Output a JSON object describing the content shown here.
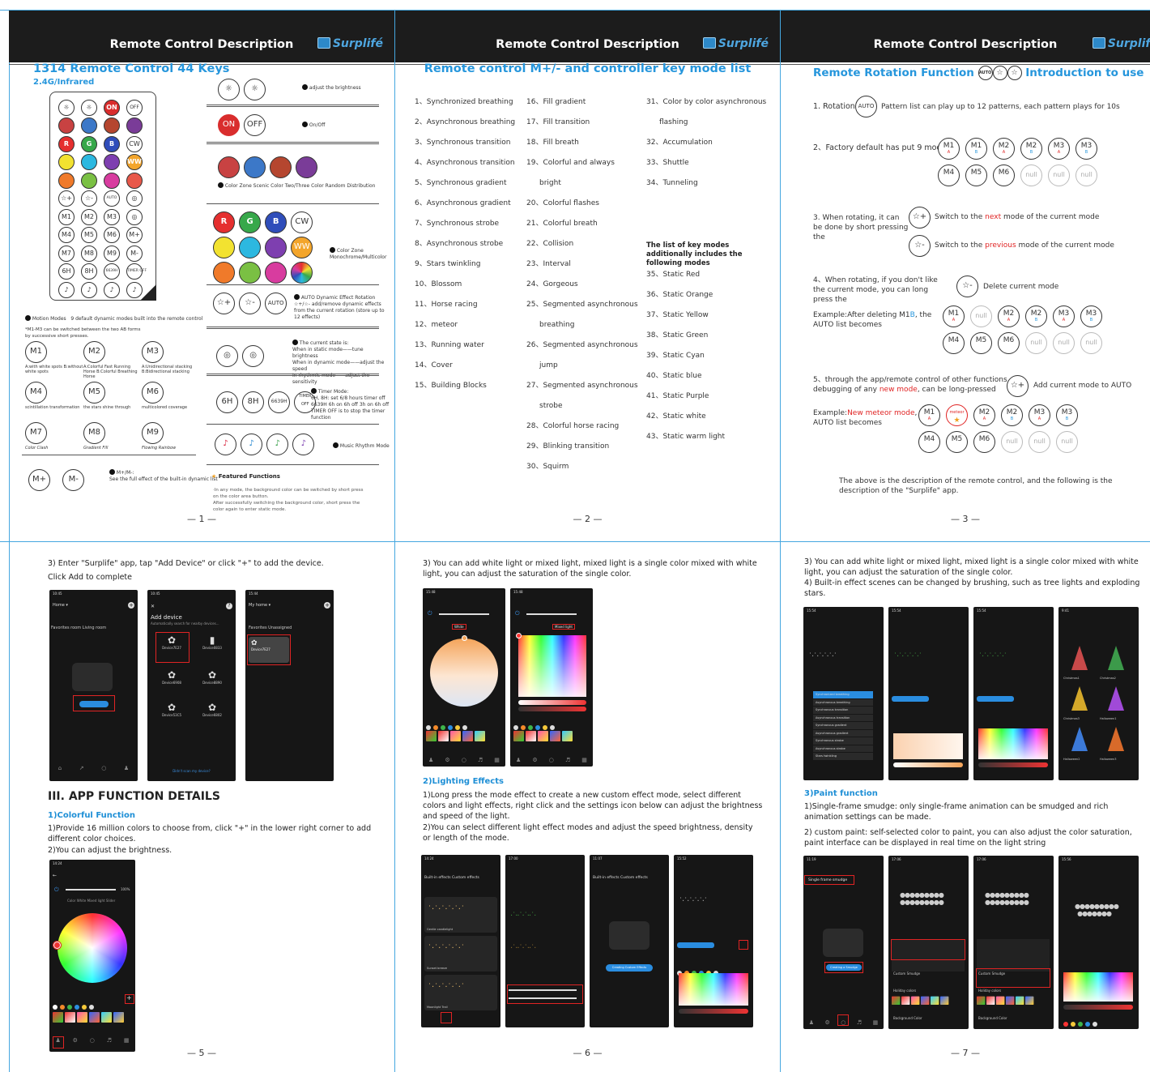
{
  "header": {
    "title": "Remote Control Description",
    "logo": "Surplifé"
  },
  "page1": {
    "title": "1314 Remote Control 44 Keys",
    "subtitle": "2.4G/Infrared",
    "remote_rows": [
      [
        {
          "t": "☼",
          "c": ""
        },
        {
          "t": "☼",
          "c": ""
        },
        {
          "t": "ON",
          "c": "#d92d2d"
        },
        {
          "t": "OFF",
          "c": ""
        }
      ],
      [
        {
          "t": "",
          "c": "#c84242"
        },
        {
          "t": "",
          "c": "#3c78c8"
        },
        {
          "t": "",
          "c": "#b5462f"
        },
        {
          "t": "",
          "c": "#7a3c98"
        }
      ],
      [
        {
          "t": "R",
          "c": "#e52f2f"
        },
        {
          "t": "G",
          "c": "#37a84a"
        },
        {
          "t": "B",
          "c": "#2f4dba"
        },
        {
          "t": "CW",
          "c": ""
        }
      ],
      [
        {
          "t": "",
          "c": "#f2e230"
        },
        {
          "t": "",
          "c": "#2cb8e0"
        },
        {
          "t": "",
          "c": "#7e3fb0"
        },
        {
          "t": "WW",
          "c": "#f3a52b"
        }
      ],
      [
        {
          "t": "",
          "c": "#f07a2a"
        },
        {
          "t": "",
          "c": "#7ac043"
        },
        {
          "t": "",
          "c": "#d83c9f"
        },
        {
          "t": "",
          "c": "#e8584a"
        }
      ],
      [
        {
          "t": "☆+",
          "c": ""
        },
        {
          "t": "☆-",
          "c": ""
        },
        {
          "t": "AUTO",
          "c": ""
        },
        {
          "t": "◎",
          "c": ""
        }
      ],
      [
        {
          "t": "M1",
          "c": ""
        },
        {
          "t": "M2",
          "c": ""
        },
        {
          "t": "M3",
          "c": ""
        },
        {
          "t": "◎",
          "c": ""
        }
      ],
      [
        {
          "t": "M4",
          "c": ""
        },
        {
          "t": "M5",
          "c": ""
        },
        {
          "t": "M6",
          "c": ""
        },
        {
          "t": "M+",
          "c": ""
        }
      ],
      [
        {
          "t": "M7",
          "c": ""
        },
        {
          "t": "M8",
          "c": ""
        },
        {
          "t": "M9",
          "c": ""
        },
        {
          "t": "M-",
          "c": ""
        }
      ],
      [
        {
          "t": "6H",
          "c": ""
        },
        {
          "t": "8H",
          "c": ""
        },
        {
          "t": "6639H",
          "c": ""
        },
        {
          "t": "TIMER OFF",
          "c": ""
        }
      ],
      [
        {
          "t": "♪",
          "c": ""
        },
        {
          "t": "♪",
          "c": ""
        },
        {
          "t": "♪",
          "c": ""
        },
        {
          "t": "♪",
          "c": ""
        }
      ]
    ],
    "brightness": "adjust the brightness",
    "onoff": "On/Off",
    "colorzone_scenic": "Color Zone Scenic Color   Two/Three Color Random Distribution",
    "colorzone": "Color Zone",
    "mono": "Monochrome/Multicolor",
    "auto_title": "AUTO Dynamic Effect Rotation",
    "auto_desc": "☆+/☆- add/remove dynamic effects from the current rotation (store up to 12 effects)",
    "state_title": "The current state is:",
    "state_1": "When in static mode——tune brightness",
    "state_2": "When in dynamic mode——adjust the speed",
    "state_3": "In rhythmic mode——adjust the sensitivity",
    "timer_title": "Timer Mode:",
    "timer_1": "6H, 8H: set 6/8 hours timer off",
    "timer_2": "6639H 6h on 6h off 3h on 6h off",
    "timer_3": "TIMER OFF is to stop the timer function",
    "music": "Music Rhythm Mode",
    "motion_title": "Motion Modes",
    "motion_desc": "9 default dynamic modes built into the remote control",
    "motion_note": "*M1-M3 can be switched between the two AB forms by successive short presses.",
    "modes": [
      {
        "k": "M1",
        "d": "A:with white spots B:without white spots"
      },
      {
        "k": "M2",
        "d": "A:Colorful Fast Running Horse B:Colorful Breathing Horse"
      },
      {
        "k": "M3",
        "d": "A:Unidirectional stacking B:Bidirectional stacking"
      },
      {
        "k": "M4",
        "d": "scintillation transformation"
      },
      {
        "k": "M5",
        "d": "the stars shine through"
      },
      {
        "k": "M6",
        "d": "multicolored coverage"
      },
      {
        "k": "M7",
        "d": "Color Clash"
      },
      {
        "k": "M8",
        "d": "Gradient Fill"
      },
      {
        "k": "M9",
        "d": "Flowing Rainbow"
      }
    ],
    "mplus_title": "M+/M-:",
    "mplus_desc": "See the full effect of the built-in dynamic list",
    "featured": "Featured Functions",
    "feat_1": "·In any mode, the background color can be switched by short press",
    "feat_2": "on the color area button.",
    "feat_3": "After successfully switching the background color, short press the",
    "feat_4": "color again to enter static mode.",
    "page_no": "— 1 —"
  },
  "page2": {
    "title": "Remote control M+/- and controller key mode list",
    "col1": [
      "1、Synchronized breathing",
      "2、Asynchronous breathing",
      "3、Synchronous transition",
      "4、Asynchronous transition",
      "5、Synchronous gradient",
      "6、Asynchronous gradient",
      "7、Synchronous strobe",
      "8、Asynchronous strobe",
      "9、Stars twinkling",
      "10、Blossom",
      "11、Horse racing",
      "12、meteor",
      "13、Running water",
      "14、Cover",
      "15、Building Blocks"
    ],
    "col2": [
      "16、Fill gradient",
      "17、Fill transition",
      "18、Fill breath",
      "19、Colorful and always",
      "bright",
      "20、Colorful flashes",
      "21、Colorful breath",
      "22、Collision",
      "23、Interval",
      "24、Gorgeous",
      "25、Segmented asynchronous",
      "breathing",
      "26、Segmented asynchronous",
      "jump",
      "27、Segmented asynchronous",
      "strobe",
      "28、Colorful horse racing",
      "29、Blinking transition",
      "30、Squirm"
    ],
    "col3a": [
      "31、Color by color asynchronous",
      "flashing",
      "32、Accumulation",
      "33、Shuttle",
      "34、Tunneling"
    ],
    "col3_head": "The list of key modes additionally includes the following modes",
    "col3b": [
      "35、Static Red",
      "36、Static Orange",
      "37、Static Yellow",
      "38、Static Green",
      "39、Static Cyan",
      "40、Static blue",
      "41、Static Purple",
      "42、Static white",
      "43、Static warm light"
    ],
    "page_no": "— 2 —"
  },
  "page3": {
    "title_a": "Remote Rotation Function",
    "title_b": "Introduction to use",
    "r1_label": "1. Rotation",
    "r1_text": "Pattern list can play up to 12 patterns, each pattern plays for 10s",
    "r2_label": "2、Factory default has put 9 modes",
    "r3_label": "3. When rotating, it can be done by short pressing the",
    "r3_next_a": "Switch to the ",
    "r3_next_b": "next",
    "r3_next_c": " mode of the current mode",
    "r3_prev_a": "Switch to the ",
    "r3_prev_b": "previous",
    "r3_prev_c": " mode of the current mode",
    "r4_label": "4、When rotating, if you don't like the current mode, you can long press the",
    "r4_text": "Delete current mode",
    "ex1_a": "Example:After deleting M1",
    "ex1_b": "B",
    "ex1_c": ", the AUTO list becomes",
    "r5_a": "5、through the app/remote control of other functions, debugging of any ",
    "r5_b": "new mode",
    "r5_c": ", can be long-pressed",
    "r5_text": "Add current mode to AUTO",
    "ex2_a": "Example:",
    "ex2_b": "New meteor mode",
    "ex2_c": ", AUTO list becomes",
    "meteor": "meteor",
    "closing": "The above is the description of the remote control, and the following is the description of the \"Surplife\" app.",
    "page_no": "— 3 —"
  },
  "page5": {
    "p1": "3) Enter \"Surplife\" app, tap \"Add Device\" or click \"+\" to add the device.",
    "p2": "Click Add to complete",
    "s1_home": "Home ▾",
    "s1_tabs": "Favorites   room   Living room",
    "s2_title": "Add device",
    "s2_sub": "Automatically search for nearby devices...",
    "s2_dev1": "Device7E27",
    "s2_dev2": "Device0833",
    "s2_dev3": "Device6908",
    "s2_dev4": "Device8890",
    "s2_dev5": "Device53C5",
    "s2_dev6": "Device6802",
    "s2_foot": "Didn't scan my device?",
    "s3_home": "My home ▾",
    "s3_tabs": "Favorites   Unassigned",
    "s3_dev": "Device7E27",
    "section": "III. APP FUNCTION DETAILS",
    "sub1": "1)Colorful Function",
    "t1": "1)Provide 16 million colors to choose from, click \"+\" in the lower right corner to add different color choices.",
    "t2": "2)You can adjust the brightness.",
    "tabs": "Color   White   Mixed light   Slider",
    "bright_pct": "100%",
    "page_no": "— 5 —"
  },
  "page6": {
    "p1": "3) You can add white light or mixed light, mixed light is a single color mixed with white light, you can adjust the saturation of the single color.",
    "sub": "2)Lighting Effects",
    "t1": "1)Long press the mode effect to create a new custom effect mode, select different colors and light effects, right click and the settings icon below can adjust the brightness and speed of the light.",
    "t2": "2)You can select different light effect modes and adjust the speed brightness, density or length of the mode.",
    "white_tab": "White",
    "mixed_tab": "Mixed light",
    "e1": "Built-in effects   Custom effects",
    "e_items": [
      "Gentle candlelight",
      "Sunset breeze",
      "Moonlight Trail"
    ],
    "e3_btn": "Creating Custom Effects",
    "page_no": "— 6 —"
  },
  "page7": {
    "p1": "3) You can add white light or mixed light, mixed light is a single color mixed with white light, you can adjust the saturation of the single color.",
    "p2": "4) Built-in effect scenes can be changed by brushing, such as tree lights and exploding stars.",
    "list_items": [
      "Synchronized breathing",
      "Asynchronous breathing",
      "Synchronous transition",
      "Asynchronous transition",
      "Synchronous gradient",
      "Asynchronous gradient",
      "Synchronous strobe",
      "Asynchronous strobe",
      "Stars twinkling"
    ],
    "trees": [
      "Christmas1",
      "Christmas2",
      "Christmas3",
      "Halloween1",
      "Halloween2",
      "Halloween3"
    ],
    "sub": "3)Paint function",
    "t1": "1)Single-frame smudge: only single-frame animation can be smudged and rich animation settings can be made.",
    "t2": "2) custom paint: self-selected color to paint, you can also adjust the color saturation, paint interface can be displayed in real time on the light string",
    "smudge": "Single frame smudge",
    "create": "Creating a Smudge",
    "custom": "Custom Smudge",
    "holiday": "Holiday colors",
    "bg": "Background Color",
    "page_no": "— 7 —"
  }
}
